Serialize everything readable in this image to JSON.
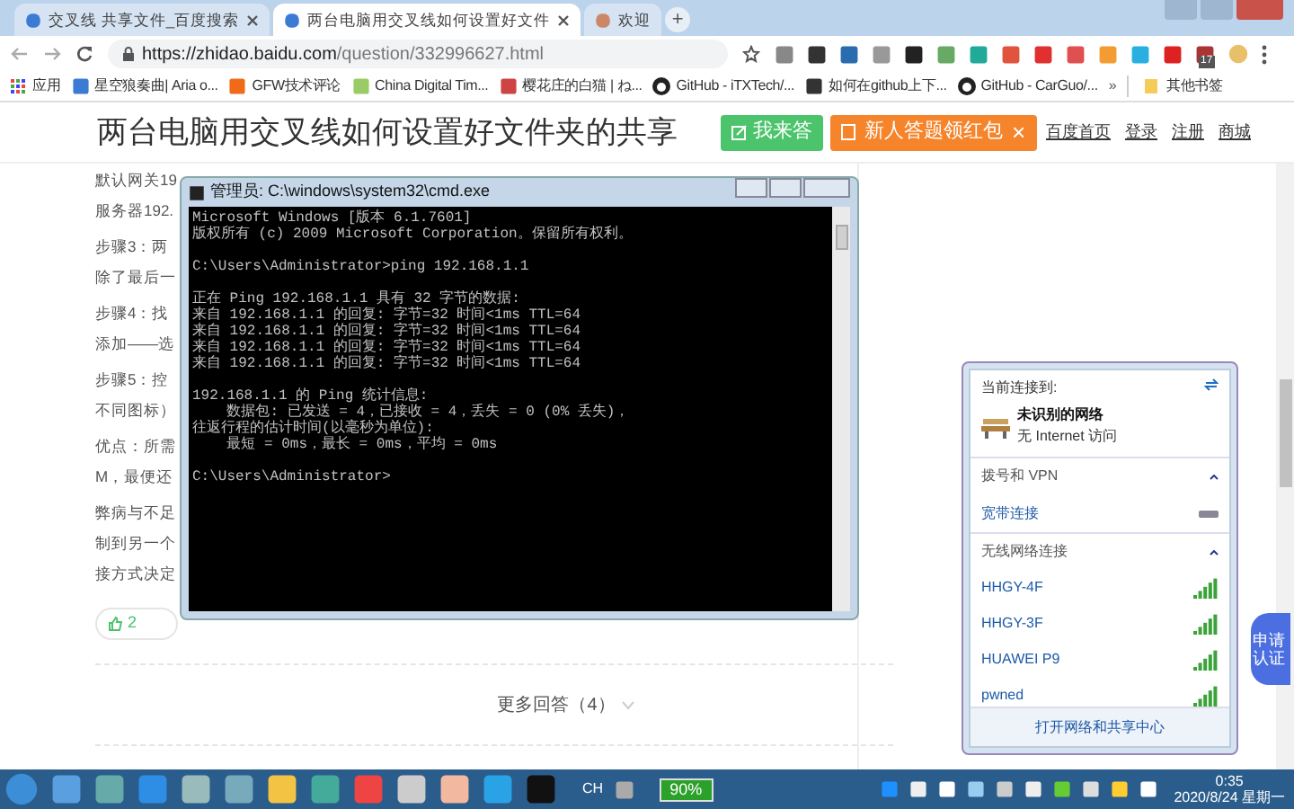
{
  "browser": {
    "tabs": [
      {
        "label": "交叉线 共享文件_百度搜索",
        "selected": false
      },
      {
        "label": "两台电脑用交叉线如何设置好文件",
        "selected": true
      },
      {
        "label": "欢迎",
        "selected": false
      }
    ],
    "new_tab": "+",
    "url_host": "https://zhidao.baidu.com",
    "url_path": "/question/332996627.html",
    "extension_badge": "17",
    "bookmarks": [
      {
        "label": "应用",
        "kind": "apps"
      },
      {
        "label": "星空狼奏曲| Aria o...",
        "kind": "site"
      },
      {
        "label": "GFW技术评论",
        "kind": "site"
      },
      {
        "label": "China Digital Tim...",
        "kind": "site"
      },
      {
        "label": "樱花庄的白猫 | ね...",
        "kind": "site"
      },
      {
        "label": "GitHub - iTXTech/...",
        "kind": "github"
      },
      {
        "label": "如何在github上下...",
        "kind": "site"
      },
      {
        "label": "GitHub - CarGuo/...",
        "kind": "github"
      }
    ],
    "more_bookmarks": "»",
    "other_bookmarks": "其他书签"
  },
  "page": {
    "title": "两台电脑用交叉线如何设置好文件夹的共享",
    "answer_button": "我来答",
    "promo": "新人答题领红包",
    "promo_close": "×",
    "links": [
      "百度首页",
      "登录",
      "注册",
      "商城"
    ],
    "paragraphs": [
      [
        "默认网关19",
        "服务器192."
      ],
      [
        "步骤3：两",
        "除了最后一"
      ],
      [
        "步骤4：找",
        "添加——选"
      ],
      [
        "步骤5：控",
        "不同图标）"
      ],
      [
        "优点：所需",
        "M，最便还"
      ],
      [
        "弊病与不足",
        "制到另一个",
        "接方式决定"
      ]
    ],
    "likes": "2",
    "more_answers": "更多回答（4）",
    "badge": "申请认证"
  },
  "cmd": {
    "title": "管理员: C:\\windows\\system32\\cmd.exe",
    "blocks": [
      [
        "Microsoft Windows [版本 6.1.7601]",
        "版权所有 (c) 2009 Microsoft Corporation。保留所有权利。"
      ],
      [
        "C:\\Users\\Administrator>ping 192.168.1.1"
      ],
      [
        "正在 Ping 192.168.1.1 具有 32 字节的数据:",
        "来自 192.168.1.1 的回复: 字节=32 时间<1ms TTL=64",
        "来自 192.168.1.1 的回复: 字节=32 时间<1ms TTL=64",
        "来自 192.168.1.1 的回复: 字节=32 时间<1ms TTL=64",
        "来自 192.168.1.1 的回复: 字节=32 时间<1ms TTL=64"
      ],
      [
        "192.168.1.1 的 Ping 统计信息:",
        "    数据包: 已发送 = 4，已接收 = 4，丢失 = 0 (0% 丢失)，",
        "往返行程的估计时间(以毫秒为单位):",
        "    最短 = 0ms，最长 = 0ms，平均 = 0ms"
      ],
      [
        "C:\\Users\\Administrator>"
      ]
    ]
  },
  "network": {
    "current_label": "当前连接到:",
    "current_name": "未识别的网络",
    "current_status": "无 Internet 访问",
    "vpn_header": "拨号和 VPN",
    "vpn_items": [
      "宽带连接"
    ],
    "wifi_header": "无线网络连接",
    "wifi_items": [
      "HHGY-4F",
      "HHGY-3F",
      "HUAWEI P9",
      "pwned"
    ],
    "footer": "打开网络和共享中心"
  },
  "taskbar": {
    "language": "CH",
    "battery": "90%",
    "time": "0:35",
    "date": "2020/8/24 星期一"
  }
}
